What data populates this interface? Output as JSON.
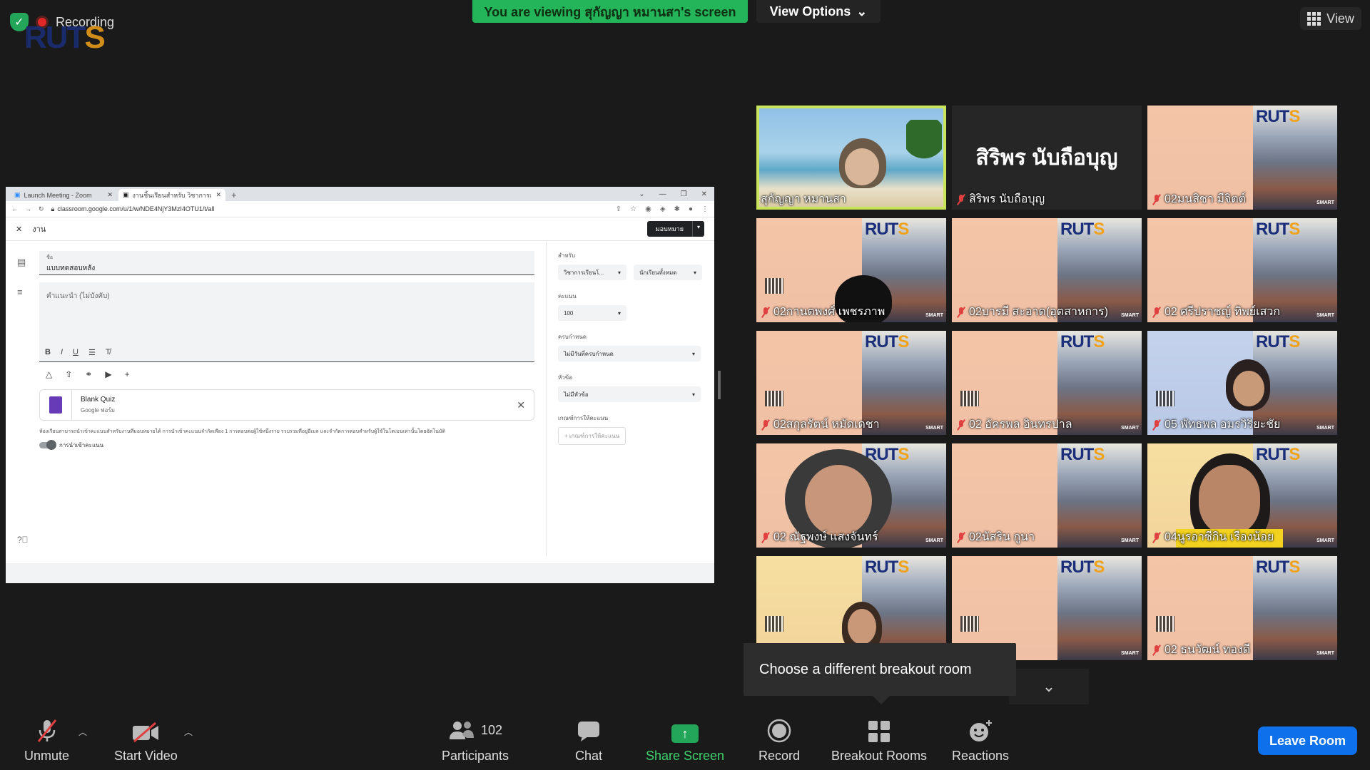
{
  "top": {
    "recording_label": "Recording",
    "logo_text": "RUTS",
    "viewing_banner": "You are viewing สุกัญญา หมานสา's screen",
    "view_options_label": "View Options",
    "view_label": "View"
  },
  "browser": {
    "tab1": "Launch Meeting - Zoom",
    "tab2": "งานชิ้นเรียนสำหรับ วิชาการเรียนโ...",
    "url": "classroom.google.com/u/1/w/NDE4NjY3MzI4OTU1/t/all",
    "header_title": "งาน",
    "assign_button": "มอบหมาย",
    "title_label": "ชื่อ",
    "title_value": "แบบทดสอบหลัง",
    "instructions_placeholder": "คำแนะนำ (ไม่บังคับ)",
    "quiz_title": "Blank Quiz",
    "quiz_subtitle": "Google ฟอร์ม",
    "grade_note": "ห้องเรียนสามารถนำเข้าคะแนนสำหรับงานที่มอบหมายได้ การนำเข้าคะแนนจำกัดเพียง 1 การตอบต่อผู้ใช้หนึ่งราย รวบรวมที่อยู่อีเมล และจำกัดการตอบสำหรับผู้ใช้ในโดเมนเท่านั้นโดยอัตโนมัติ",
    "toggle_label": "การนำเข้าคะแนน",
    "for_label": "สำหรับ",
    "class_select": "วิชาการเรียนโ...",
    "students_select": "นักเรียนทั้งหมด",
    "points_label": "คะแนน",
    "points_value": "100",
    "due_label": "ครบกำหนด",
    "due_value": "ไม่มีวันที่ครบกำหนด",
    "topic_label": "หัวข้อ",
    "topic_value": "ไม่มีหัวข้อ",
    "rubric_label": "เกณฑ์การให้คะแนน",
    "rubric_button": "+ เกณฑ์การให้คะแนน"
  },
  "participants": [
    {
      "name": "สุกัญญา หมานสา",
      "muted": false,
      "tile": "video-beach"
    },
    {
      "name": "สิริพร นับถือบุญ",
      "muted": true,
      "tile": "name-only",
      "big_name": "สิริพร นับถือบุญ"
    },
    {
      "name": "02มนสิชา มีจิตต์",
      "muted": true,
      "tile": "slide"
    },
    {
      "name": "02กานตพงศ์ เพชรภาพ",
      "muted": true,
      "tile": "slide"
    },
    {
      "name": "02บารมี สะอาด(อุตสาหการ)",
      "muted": true,
      "tile": "slide"
    },
    {
      "name": "02 ศรีปราชญ์ ทิพย์เสวก",
      "muted": true,
      "tile": "slide"
    },
    {
      "name": "02สกุลรัตน์ หมัดเดชา",
      "muted": true,
      "tile": "slide"
    },
    {
      "name": "02 อัครพล อินทรปาล",
      "muted": true,
      "tile": "slide"
    },
    {
      "name": "05 พัทธพล อมรวิริยะชัย",
      "muted": true,
      "tile": "slide-blue"
    },
    {
      "name": "02 ณัฐพงษ์ แสงจันทร์",
      "muted": true,
      "tile": "slide"
    },
    {
      "name": "02นัสริน กูนา",
      "muted": true,
      "tile": "slide"
    },
    {
      "name": "04นูรอาซีกิน เรืองน้อย",
      "muted": true,
      "tile": "slide-yellow"
    },
    {
      "name": "",
      "muted": false,
      "tile": "slide-yellow"
    },
    {
      "name": "",
      "muted": false,
      "tile": "slide"
    },
    {
      "name": "02 ธนวัฒน์ ทองดี",
      "muted": true,
      "tile": "slide"
    }
  ],
  "tooltip": "Choose a different breakout room",
  "toolbar": {
    "unmute": "Unmute",
    "start_video": "Start Video",
    "participants": "Participants",
    "participants_count": "102",
    "chat": "Chat",
    "share_screen": "Share Screen",
    "record": "Record",
    "breakout_rooms": "Breakout Rooms",
    "reactions": "Reactions",
    "leave_room": "Leave Room"
  },
  "colors": {
    "share_green": "#23a55a",
    "leave_blue": "#0e71eb",
    "speaker_outline": "#c9e35a",
    "muted_red": "#e04040"
  }
}
